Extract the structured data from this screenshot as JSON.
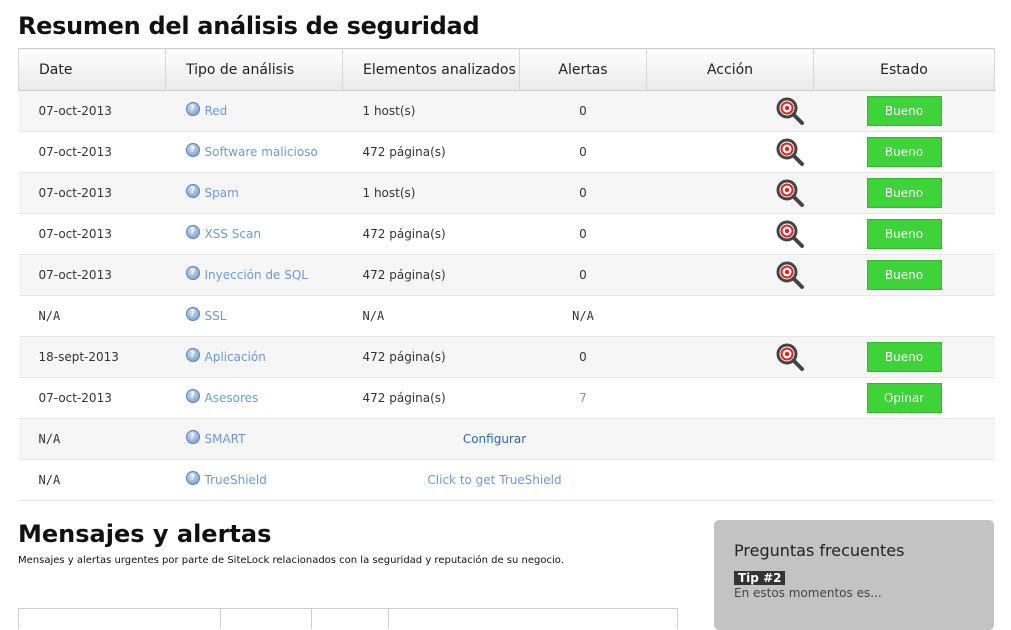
{
  "title": "Resumen del análisis de seguridad",
  "table": {
    "headers": {
      "date": "Date",
      "type": "Tipo de análisis",
      "elements": "Elementos analizados",
      "alerts": "Alertas",
      "action": "Acción",
      "status": "Estado"
    },
    "rows": [
      {
        "date": "07-oct-2013",
        "type": "Red",
        "elements": "1 host(s)",
        "alerts": "0",
        "status": "Bueno"
      },
      {
        "date": "07-oct-2013",
        "type": "Software malicioso",
        "elements": "472 página(s)",
        "alerts": "0",
        "status": "Bueno"
      },
      {
        "date": "07-oct-2013",
        "type": "Spam",
        "elements": "1 host(s)",
        "alerts": "0",
        "status": "Bueno"
      },
      {
        "date": "07-oct-2013",
        "type": "XSS Scan",
        "elements": "472 página(s)",
        "alerts": "0",
        "status": "Bueno"
      },
      {
        "date": "07-oct-2013",
        "type": "Inyección de SQL",
        "elements": "472 página(s)",
        "alerts": "0",
        "status": "Bueno"
      },
      {
        "date": "N/A",
        "type": "SSL",
        "elements": "N/A",
        "alerts": "N/A"
      },
      {
        "date": "18-sept-2013",
        "type": "Aplicación",
        "elements": "472 página(s)",
        "alerts": "0",
        "status": "Bueno"
      },
      {
        "date": "07-oct-2013",
        "type": "Asesores",
        "elements": "472 página(s)",
        "alerts": "7",
        "status": "Opinar"
      },
      {
        "date": "N/A",
        "type": "SMART",
        "link": "Configurar"
      },
      {
        "date": "N/A",
        "type": "TrueShield",
        "link": "Click to get TrueShield"
      }
    ]
  },
  "messages": {
    "title": "Mensajes y alertas",
    "subtitle": "Mensajes y alertas urgentes por parte de SiteLock relacionados con la seguridad y reputación de su negocio."
  },
  "faq": {
    "title": "Preguntas frecuentes",
    "tip_label": "Tip #2",
    "tip_text": "En estos momentos es..."
  },
  "icons": {
    "help": "help-icon",
    "action": "magnifier-target-icon"
  },
  "colors": {
    "status_green": "#3fd33a",
    "link_blue": "#6b9bd0"
  }
}
